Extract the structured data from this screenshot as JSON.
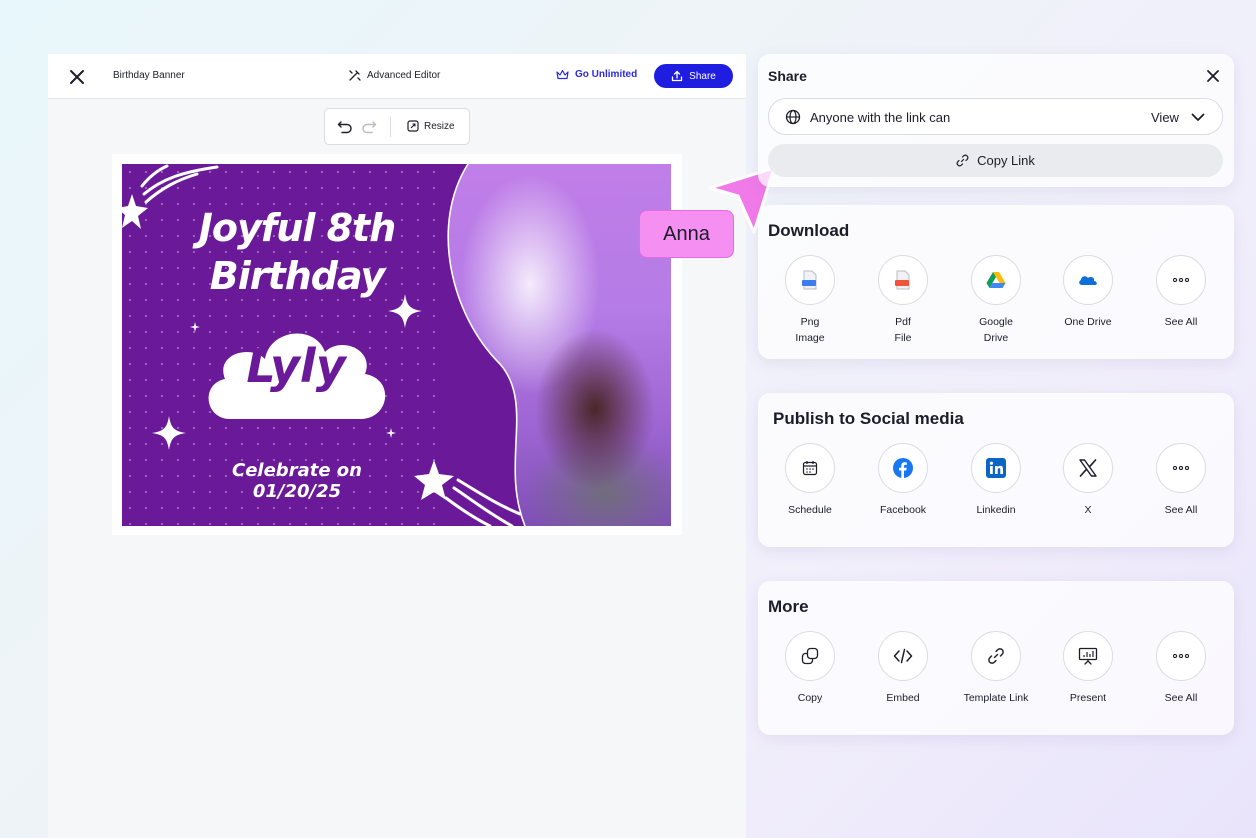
{
  "editor": {
    "doc_title": "Birthday Banner",
    "advanced_editor": "Advanced Editor",
    "go_unlimited": "Go Unlimited",
    "share": "Share",
    "resize": "Resize"
  },
  "banner": {
    "title_line1": "Joyful 8th",
    "title_line2": "Birthday",
    "name": "Lyly",
    "celebrate": "Celebrate on 01/20/25"
  },
  "collaborator": {
    "name": "Anna",
    "color": "#f58ff2"
  },
  "share_panel": {
    "title": "Share",
    "permission_text": "Anyone with the link can",
    "permission_value": "View",
    "copy_link": "Copy Link"
  },
  "download": {
    "title": "Download",
    "items": [
      {
        "line1": "Png",
        "line2": "Image",
        "icon": "png-file-icon"
      },
      {
        "line1": "Pdf",
        "line2": "File",
        "icon": "pdf-file-icon"
      },
      {
        "line1": "Google",
        "line2": "Drive",
        "icon": "google-drive-icon"
      },
      {
        "line1": "One Drive",
        "line2": "",
        "icon": "onedrive-icon"
      },
      {
        "line1": "See All",
        "line2": "",
        "icon": "more-dots-icon"
      }
    ]
  },
  "social": {
    "title": "Publish to Social media",
    "items": [
      {
        "label": "Schedule",
        "icon": "calendar-icon"
      },
      {
        "label": "Facebook",
        "icon": "facebook-icon"
      },
      {
        "label": "Linkedin",
        "icon": "linkedin-icon"
      },
      {
        "label": "X",
        "icon": "x-icon"
      },
      {
        "label": "See All",
        "icon": "more-dots-icon"
      }
    ]
  },
  "more": {
    "title": "More",
    "items": [
      {
        "label": "Copy",
        "icon": "copy-icon"
      },
      {
        "label": "Embed",
        "icon": "code-icon"
      },
      {
        "label": "Template Link",
        "icon": "link-icon"
      },
      {
        "label": "Present",
        "icon": "presentation-icon"
      },
      {
        "label": "See All",
        "icon": "more-dots-icon"
      }
    ]
  },
  "colors": {
    "accent": "#1f1ee0",
    "banner_purple": "#6a1a98"
  }
}
